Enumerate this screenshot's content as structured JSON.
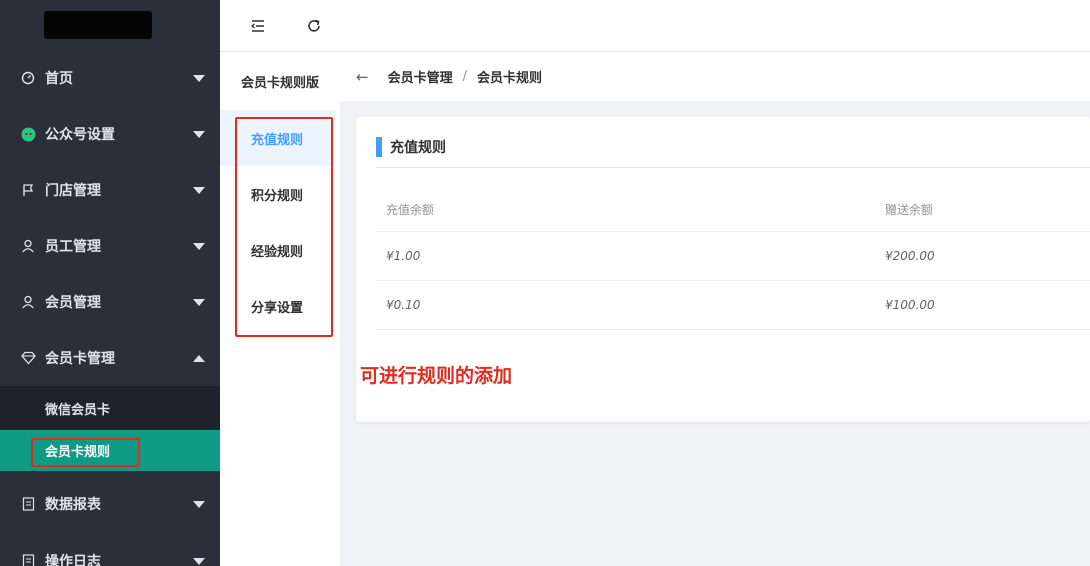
{
  "sidebar": {
    "items": [
      {
        "label": "首页",
        "icon": "dashboard-icon"
      },
      {
        "label": "公众号设置",
        "icon": "wechat-icon"
      },
      {
        "label": "门店管理",
        "icon": "flag-icon"
      },
      {
        "label": "员工管理",
        "icon": "user-icon"
      },
      {
        "label": "会员管理",
        "icon": "user-icon"
      },
      {
        "label": "会员卡管理",
        "icon": "diamond-icon"
      }
    ],
    "submenu": [
      {
        "label": "微信会员卡"
      },
      {
        "label": "会员卡规则"
      }
    ],
    "items_after": [
      {
        "label": "数据报表",
        "icon": "document-icon"
      },
      {
        "label": "操作日志",
        "icon": "document-icon"
      }
    ]
  },
  "topbar": {
    "icons": [
      "menu-fold-icon",
      "refresh-icon"
    ]
  },
  "side2": {
    "title": "会员卡规则版",
    "items": [
      "充值规则",
      "积分规则",
      "经验规则",
      "分享设置"
    ]
  },
  "breadcrumb": {
    "back": "←",
    "level1": "会员卡管理",
    "separator": "/",
    "level2": "会员卡规则"
  },
  "card": {
    "title": "充值规则",
    "columns": [
      "充值余额",
      "赠送余额"
    ],
    "rows": [
      [
        "¥1.00",
        "¥200.00"
      ],
      [
        "¥0.10",
        "¥100.00"
      ]
    ]
  },
  "annotation": "可进行规则的添加",
  "colors": {
    "accent": "#409eff",
    "active_menu": "#0f9b83",
    "highlight_red": "#e02b1f",
    "sidebar_bg": "#2b2f3a"
  }
}
